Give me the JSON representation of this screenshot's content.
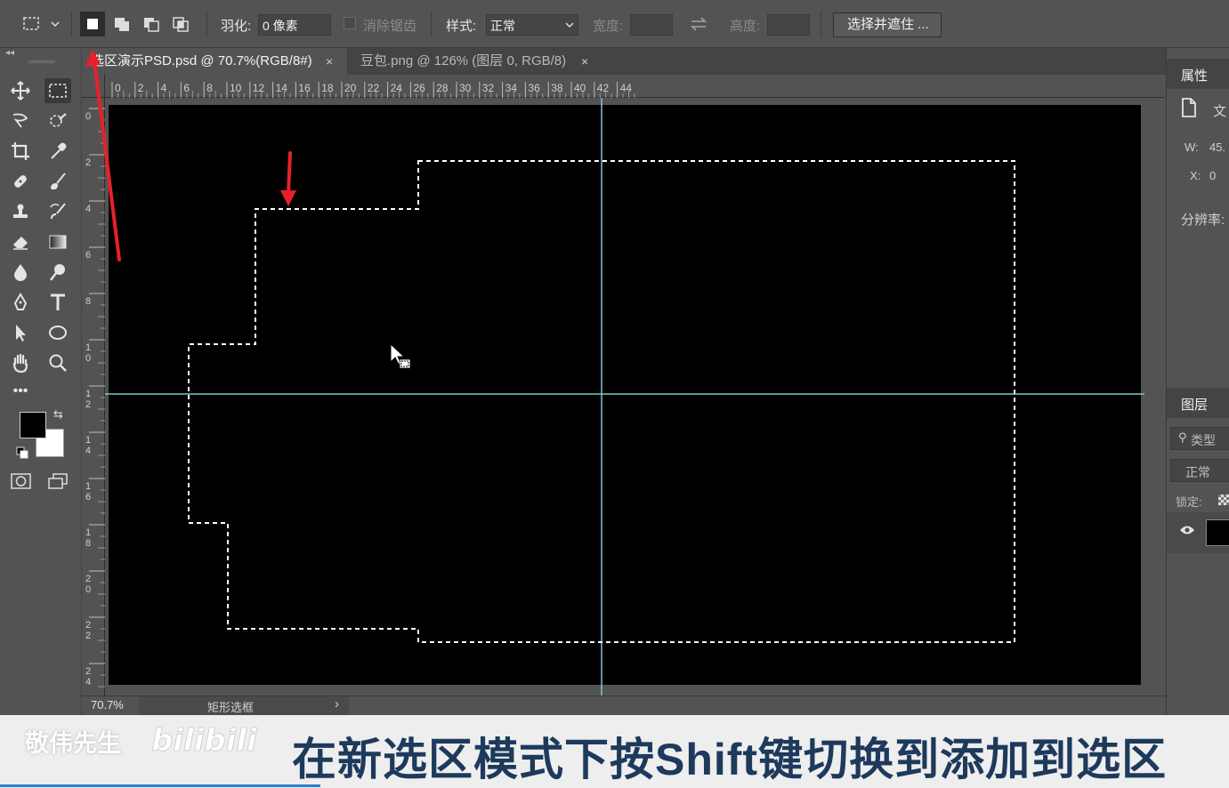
{
  "options_bar": {
    "marquee_icon": "rect-marquee-icon",
    "selection_modes": [
      "new-selection-icon",
      "add-to-selection-icon",
      "subtract-from-selection-icon",
      "intersect-selection-icon"
    ],
    "feather_label": "羽化:",
    "feather_value": "0 像素",
    "antialias_label": "消除锯齿",
    "style_label": "样式:",
    "style_value": "正常",
    "width_label": "宽度:",
    "height_label": "高度:",
    "select_mask_button": "选择并遮住 ..."
  },
  "tabs": [
    {
      "label": "选区演示PSD.psd @ 70.7%(RGB/8#)",
      "close": "×",
      "active": true
    },
    {
      "label": "豆包.png @ 126% (图层 0, RGB/8)",
      "close": "×",
      "active": false
    }
  ],
  "ruler": {
    "h_labels": [
      "0",
      "2",
      "4",
      "6",
      "8",
      "10",
      "12",
      "14",
      "16",
      "18",
      "20",
      "22",
      "24",
      "26",
      "28",
      "30",
      "32",
      "34",
      "36",
      "38",
      "40",
      "42",
      "44"
    ],
    "v_labels": [
      "0",
      "2",
      "4",
      "6",
      "8",
      "10",
      "12",
      "14",
      "16",
      "18",
      "20",
      "22",
      "24"
    ]
  },
  "status": {
    "zoom": "70.7%",
    "tool_name": "矩形选框",
    "arrow": "›"
  },
  "properties_panel": {
    "title": "属性",
    "doc_label": "文",
    "w_label": "W:",
    "w_value": "45.",
    "x_label": "X:",
    "x_value": "0",
    "resolution_label": "分辨率:"
  },
  "layers_panel": {
    "title": "图层",
    "search_label": "类型",
    "blend_mode": "正常",
    "lock_label": "锁定:"
  },
  "caption": {
    "watermark": "敬伟先生",
    "text": "在新选区模式下按Shift键切换到添加到选区"
  },
  "colors": {
    "annotation_arrow": "#e8202a",
    "guide": "#7fc4d6",
    "caption_text": "#1d3a5c",
    "ui_background": "#535353"
  }
}
